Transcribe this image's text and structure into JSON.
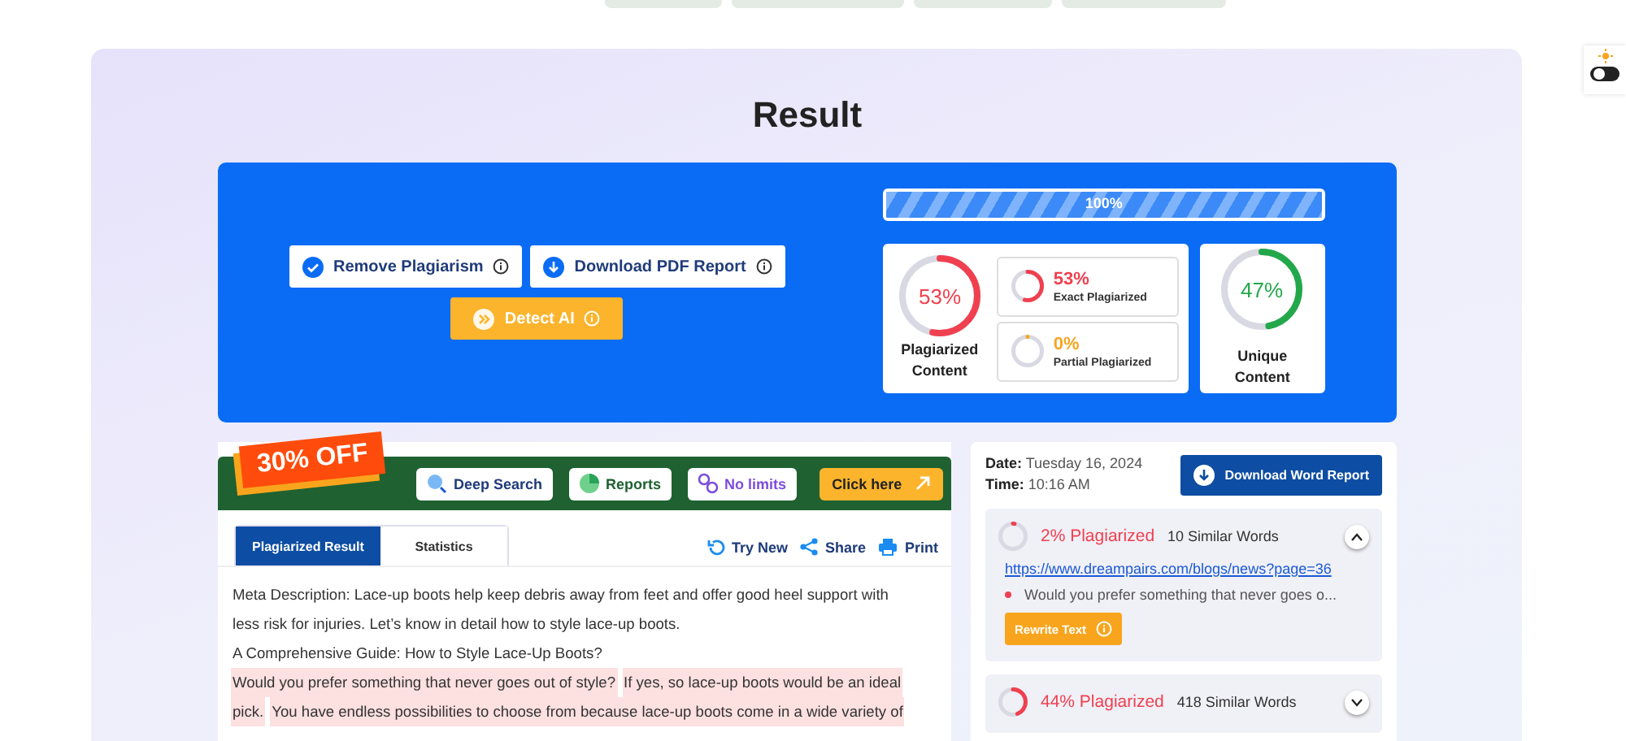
{
  "top_tabs": [
    {
      "selected": false
    },
    {
      "selected": false
    },
    {
      "selected": false
    },
    {
      "selected": false
    }
  ],
  "theme_toggle": {
    "on": false
  },
  "title": "Result",
  "actions": [
    {
      "kind": "check",
      "label": "Remove Plagiarism"
    },
    {
      "kind": "download",
      "label": "Download PDF Report"
    }
  ],
  "detect_ai": {
    "label": "Detect AI"
  },
  "progress": {
    "level": 1,
    "reading": "100%"
  },
  "plagiarized": {
    "value": "53%",
    "label": "Plagiarized Content",
    "level": 0.53
  },
  "breakdown": [
    {
      "value": "53%",
      "label": "Exact Plagiarized",
      "level": 0.53,
      "color": "#f0404f"
    },
    {
      "value": "0%",
      "label": "Partial Plagiarized",
      "level": 0,
      "color": "#f5a623"
    }
  ],
  "unique": {
    "value": "47%",
    "label": "Unique Content",
    "level": 0.47
  },
  "promo": {
    "badge": "30% OFF",
    "features": [
      {
        "kind": "search",
        "label": "Deep Search"
      },
      {
        "kind": "pie",
        "label": "Reports"
      },
      {
        "kind": "infinity",
        "label": "No limits"
      }
    ],
    "cta": "Click here"
  },
  "result_tabs": [
    {
      "label": "Plagiarized Result",
      "selected": true
    },
    {
      "label": "Statistics",
      "selected": false
    }
  ],
  "tools": [
    {
      "kind": "refresh",
      "label": "Try New"
    },
    {
      "kind": "share",
      "label": "Share"
    },
    {
      "kind": "print",
      "label": "Print"
    }
  ],
  "lines": [
    [
      {
        "text": "Meta Description: Lace-up boots help keep debris away from feet and offer good heel support with",
        "highlighted": false
      }
    ],
    [
      {
        "text": "less risk for injuries. Let’s know in detail how to style lace-up boots.",
        "highlighted": false
      }
    ],
    [
      {
        "text": "A Comprehensive Guide: How to Style Lace-Up Boots?",
        "highlighted": false
      }
    ],
    [
      {
        "text": "Would you prefer something that never goes out of style?",
        "highlighted": true
      },
      {
        "text": "If yes, so lace-up boots would be an ideal",
        "highlighted": true
      }
    ],
    [
      {
        "text": "pick.",
        "highlighted": true
      },
      {
        "text": "You have endless possibilities to choose from because lace-up boots come in a wide variety of",
        "highlighted": true
      }
    ]
  ],
  "report": {
    "date_label": "Date:",
    "date": "Tuesday 16, 2024",
    "time_label": "Time:",
    "time": "10:16 AM",
    "download": "Download Word Report"
  },
  "sources": [
    {
      "percent": "2% Plagiarized",
      "level": 0.02,
      "words": "10 Similar Words",
      "expanded": true,
      "url": "https://www.dreampairs.com/blogs/news?page=36",
      "snippet": "Would you prefer something that never goes o...",
      "action": "Rewrite Text"
    },
    {
      "percent": "44% Plagiarized",
      "level": 0.44,
      "words": "418 Similar Words",
      "expanded": false
    }
  ]
}
